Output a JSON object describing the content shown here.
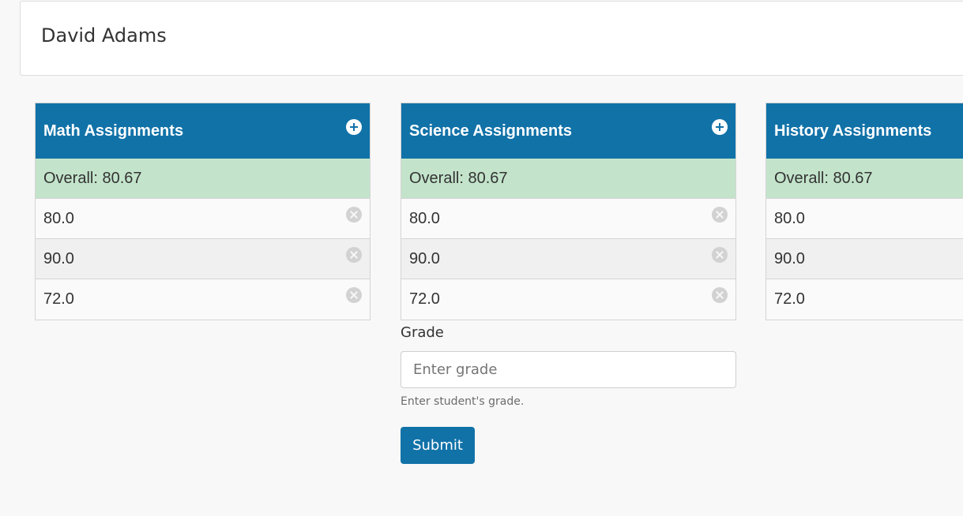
{
  "student": {
    "name": "David Adams"
  },
  "panels": [
    {
      "title": "Math Assignments",
      "overall": "Overall: 80.67",
      "grades": [
        "80.0",
        "90.0",
        "72.0"
      ]
    },
    {
      "title": "Science Assignments",
      "overall": "Overall: 80.67",
      "grades": [
        "80.0",
        "90.0",
        "72.0"
      ]
    },
    {
      "title": "History Assignments",
      "overall": "Overall: 80.67",
      "grades": [
        "80.0",
        "90.0",
        "72.0"
      ]
    }
  ],
  "form": {
    "label": "Grade",
    "placeholder": "Enter grade",
    "value": "",
    "help": "Enter student's grade.",
    "submit_label": "Submit"
  },
  "icons": {
    "add": "plus-circle-icon",
    "remove": "x-circle-icon"
  },
  "colors": {
    "header_blue": "#1172a8",
    "overall_green": "#c3e4cb",
    "remove_gray": "#d2d2d2",
    "background": "#f8f8f8"
  }
}
